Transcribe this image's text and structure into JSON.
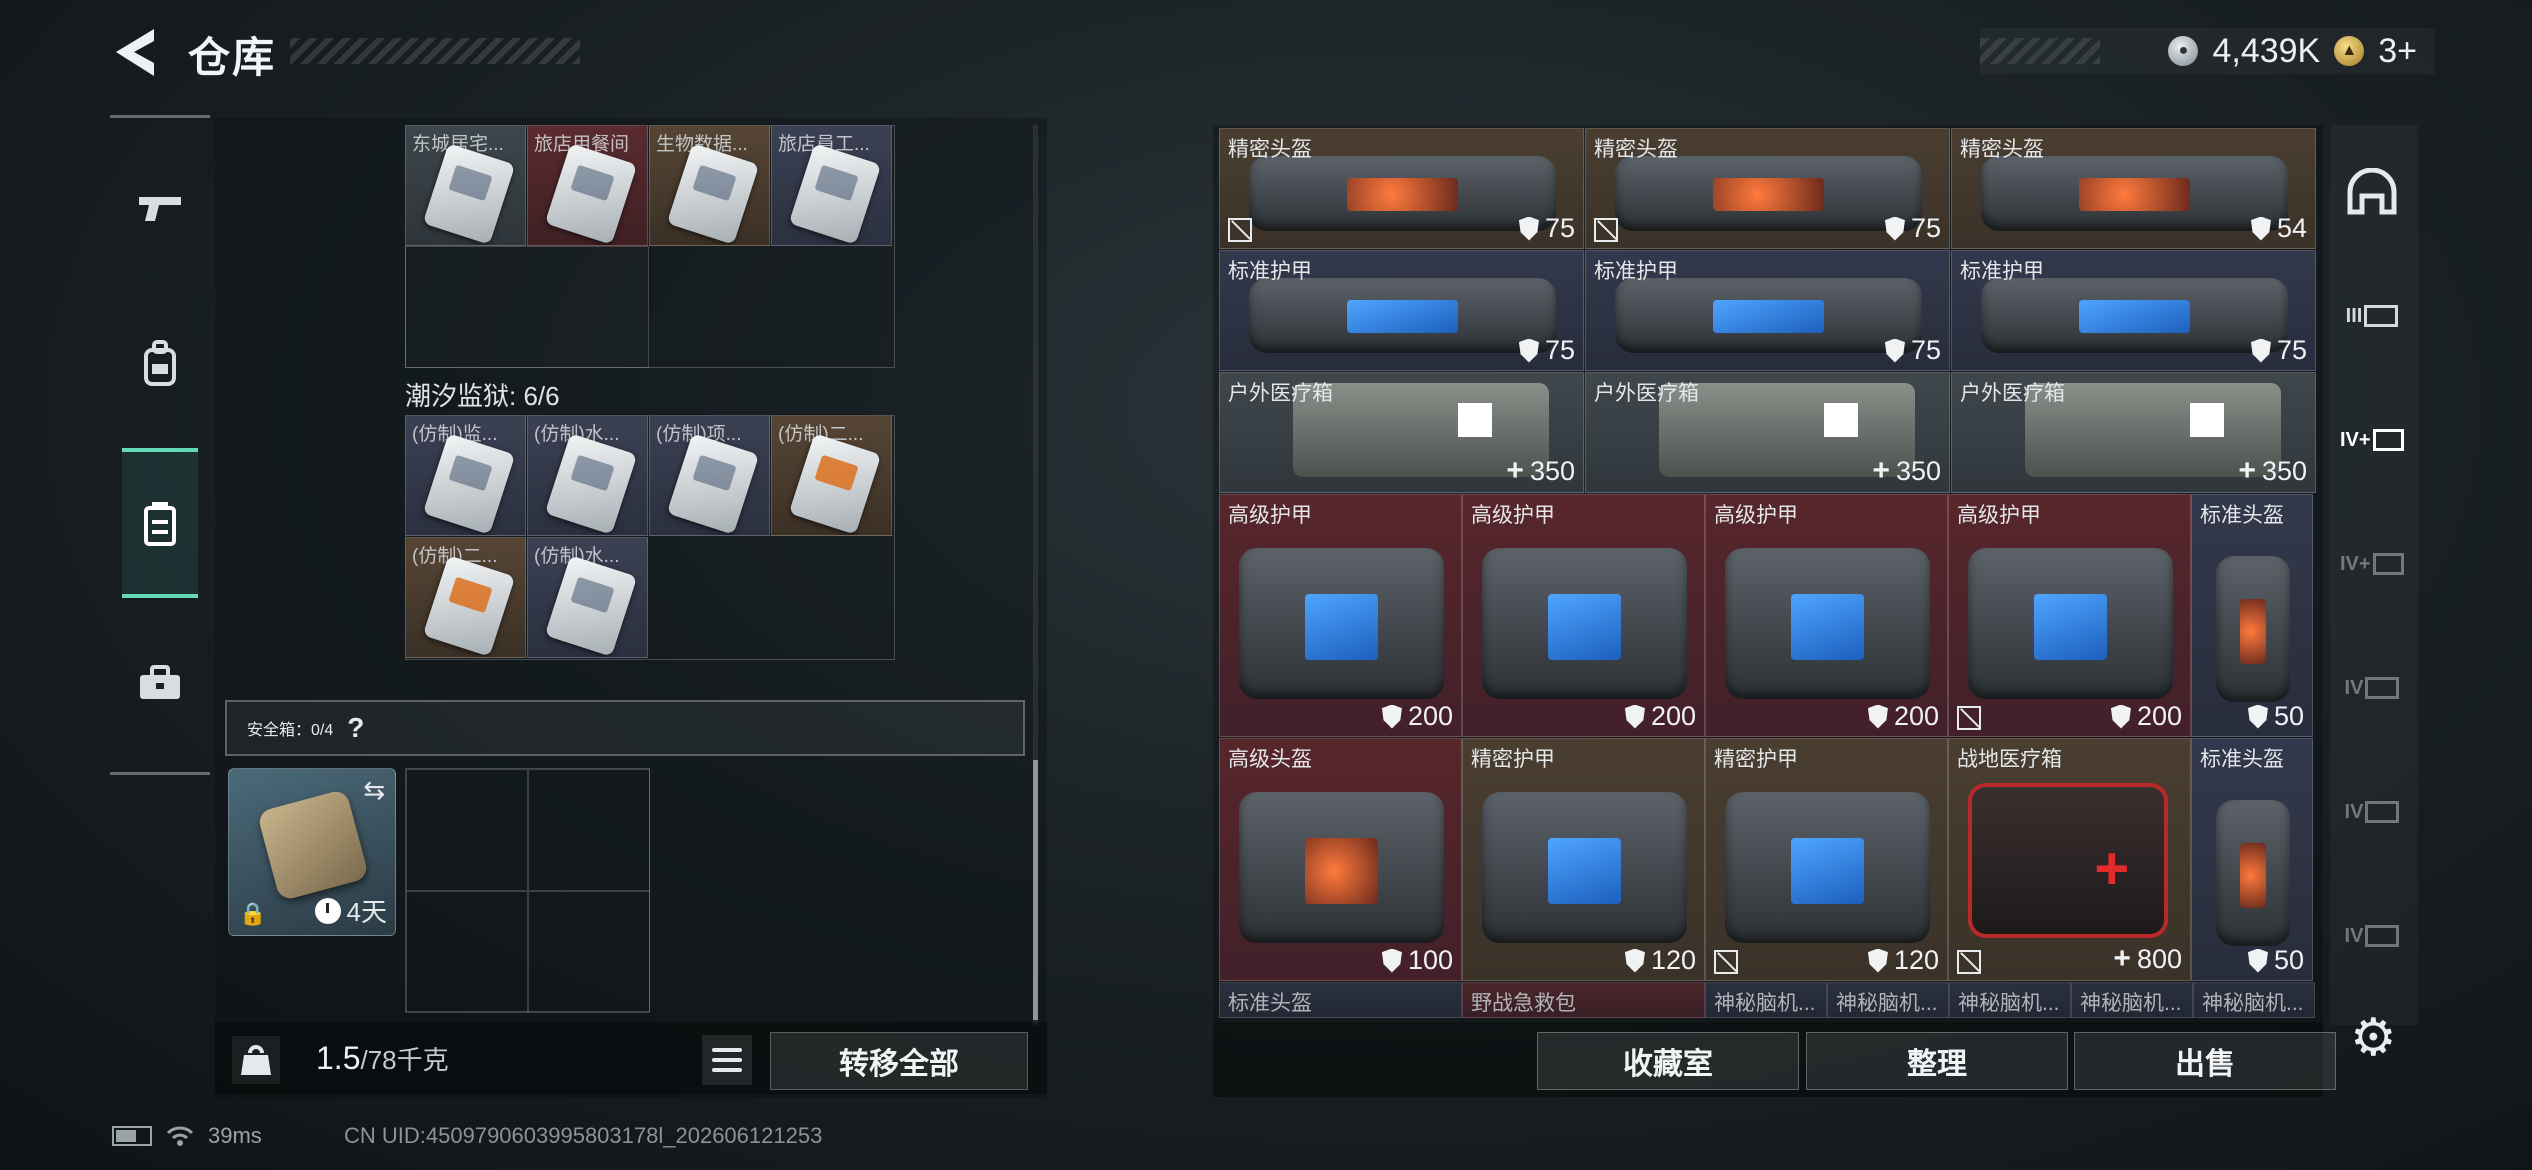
{
  "header": {
    "title": "仓库",
    "currency": [
      {
        "icon": "silver-coin-icon",
        "value": "4,439K"
      },
      {
        "icon": "gold-coin-icon",
        "value": "3+"
      }
    ]
  },
  "left_nav": [
    {
      "name": "weapons",
      "icon": "pistol-icon"
    },
    {
      "name": "backpack",
      "icon": "backpack-icon"
    },
    {
      "name": "container",
      "icon": "container-icon",
      "active": true
    },
    {
      "name": "toolbox",
      "icon": "briefcase-icon"
    }
  ],
  "stash": {
    "top_cards": [
      {
        "label": "东城居宅...",
        "bg": "grey"
      },
      {
        "label": "旅店用餐间",
        "bg": "red"
      },
      {
        "label": "生物数据...",
        "bg": "brown"
      },
      {
        "label": "旅店員工...",
        "bg": "blue"
      }
    ],
    "section_title": "潮汐监狱: 6/6",
    "prison_cards": [
      {
        "label": "(仿制)监...",
        "bg": "blue",
        "accent": false
      },
      {
        "label": "(仿制)水...",
        "bg": "blue",
        "accent": false
      },
      {
        "label": "(仿制)项...",
        "bg": "blue",
        "accent": false
      },
      {
        "label": "(仿制)二...",
        "bg": "brown",
        "accent": true
      },
      {
        "label": "(仿制)二...",
        "bg": "brown",
        "accent": true
      },
      {
        "label": "(仿制)水...",
        "bg": "blue",
        "accent": false
      }
    ],
    "safebox_label": "安全箱：0/4",
    "safebox_help": "?",
    "safe_item_days": "4天",
    "weight_value": "1.5",
    "weight_max": "/78千克",
    "transfer_all": "转移全部"
  },
  "inventory": {
    "rows_top": [
      [
        {
          "label": "精密头盔",
          "value": "75",
          "kind": "shield",
          "bg": "brown",
          "broken": true,
          "art": "bag-orange"
        },
        {
          "label": "精密头盔",
          "value": "75",
          "kind": "shield",
          "bg": "brown",
          "broken": true,
          "art": "bag-orange"
        },
        {
          "label": "精密头盔",
          "value": "54",
          "kind": "shield",
          "bg": "brown",
          "broken": false,
          "art": "bag-orange"
        }
      ],
      [
        {
          "label": "标准护甲",
          "value": "75",
          "kind": "shield",
          "bg": "navy",
          "broken": false,
          "art": "bag-blue"
        },
        {
          "label": "标准护甲",
          "value": "75",
          "kind": "shield",
          "bg": "navy",
          "broken": false,
          "art": "bag-blue"
        },
        {
          "label": "标准护甲",
          "value": "75",
          "kind": "shield",
          "bg": "navy",
          "broken": false,
          "art": "bag-blue"
        }
      ],
      [
        {
          "label": "户外医疗箱",
          "value": "350",
          "kind": "plus",
          "bg": "grey",
          "broken": false,
          "art": "medkit"
        },
        {
          "label": "户外医疗箱",
          "value": "350",
          "kind": "plus",
          "bg": "grey",
          "broken": false,
          "art": "medkit"
        },
        {
          "label": "户外医疗箱",
          "value": "350",
          "kind": "plus",
          "bg": "grey",
          "broken": false,
          "art": "medkit"
        }
      ]
    ],
    "row_armor": [
      {
        "label": "高级护甲",
        "value": "200",
        "kind": "shield",
        "bg": "red",
        "broken": false,
        "art": "bag-blue"
      },
      {
        "label": "高级护甲",
        "value": "200",
        "kind": "shield",
        "bg": "red",
        "broken": false,
        "art": "bag-blue"
      },
      {
        "label": "高级护甲",
        "value": "200",
        "kind": "shield",
        "bg": "red",
        "broken": false,
        "art": "bag-blue"
      },
      {
        "label": "高级护甲",
        "value": "200",
        "kind": "shield",
        "bg": "red",
        "broken": true,
        "art": "bag-blue"
      },
      {
        "label": "标准头盔",
        "value": "50",
        "kind": "shield",
        "bg": "navy",
        "broken": false,
        "art": "helmet"
      }
    ],
    "row_mixed": [
      {
        "label": "高级头盔",
        "value": "100",
        "kind": "shield",
        "bg": "red",
        "broken": false,
        "art": "bag-orange"
      },
      {
        "label": "精密护甲",
        "value": "120",
        "kind": "shield",
        "bg": "brown",
        "broken": false,
        "art": "bag-blue"
      },
      {
        "label": "精密护甲",
        "value": "120",
        "kind": "shield",
        "bg": "brown",
        "broken": true,
        "art": "bag-blue"
      },
      {
        "label": "战地医疗箱",
        "value": "800",
        "kind": "plus",
        "bg": "brown",
        "broken": true,
        "art": "redkit"
      },
      {
        "label": "标准头盔",
        "value": "50",
        "kind": "shield",
        "bg": "navy",
        "broken": false,
        "art": "helmet"
      }
    ],
    "row_partial": [
      {
        "label": "标准头盔"
      },
      {
        "label": "野战急救包"
      },
      {
        "label": "神秘脑机..."
      },
      {
        "label": "神秘脑机..."
      },
      {
        "label": "神秘脑机..."
      },
      {
        "label": "神秘脑机..."
      },
      {
        "label": "神秘脑机..."
      }
    ],
    "buttons": {
      "collection": "收藏室",
      "organize": "整理",
      "sell": "出售"
    }
  },
  "right_rail": [
    {
      "icon": "helmet-category-icon",
      "text": ""
    },
    {
      "icon": "rifle-tier-icon",
      "text": "III"
    },
    {
      "icon": "medkit-tier-icon",
      "text": "IV+"
    },
    {
      "icon": "medkit-tier-icon",
      "text": "IV+"
    },
    {
      "icon": "ammo-tier-icon",
      "text": "IV"
    },
    {
      "icon": "ammo-tier-icon",
      "text": "IV"
    },
    {
      "icon": "gun-tier-icon",
      "text": "IV"
    }
  ],
  "status_bar": {
    "ping": "39ms",
    "uid": "CN UID:4509790603995803178l_202606121253"
  }
}
